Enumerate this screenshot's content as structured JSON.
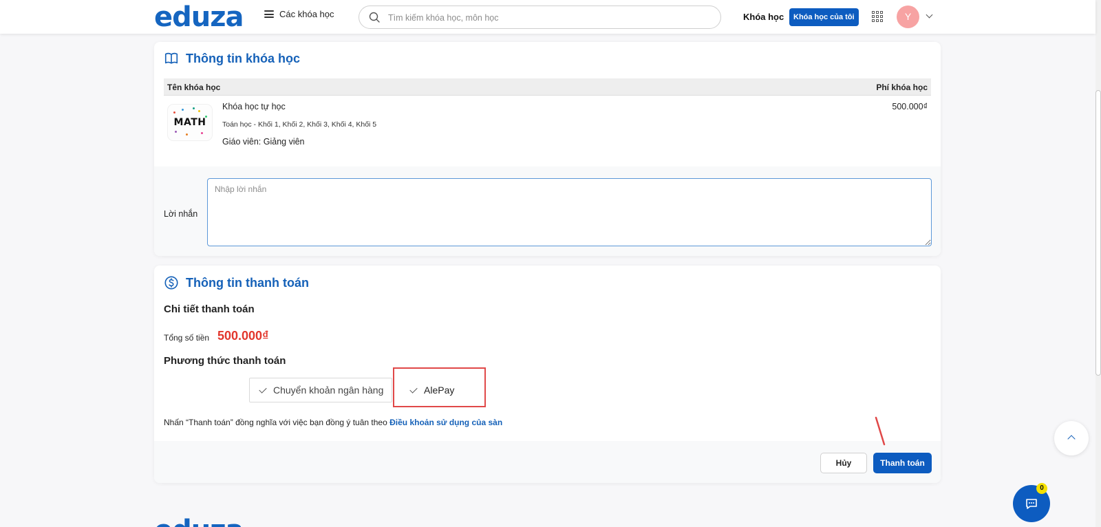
{
  "header": {
    "logo": "eduza",
    "menu_label": "Các khóa học",
    "search_placeholder": "Tìm kiếm khóa học, môn học",
    "nav_courses": "Khóa học",
    "my_courses": "Khóa học của tôi",
    "avatar_initial": "Y"
  },
  "course_card": {
    "title": "Thông tin khóa học",
    "col_name": "Tên khóa học",
    "col_fee": "Phí khóa học",
    "thumbnail_text": "MATH",
    "course": {
      "name": "Khóa học tự học",
      "subject": "Toán học - Khối 1, Khối 2, Khối 3, Khối 4, Khối 5",
      "teacher": "Giáo viên: Giảng viên",
      "price": "500.000₫"
    },
    "message_label": "Lời nhắn",
    "message_placeholder": "Nhập lời nhắn",
    "message_value": ""
  },
  "payment_card": {
    "title": "Thông tin thanh toán",
    "detail_title": "Chi tiết thanh toán",
    "total_label": "Tổng số tiền",
    "total_value": "500.000₫",
    "method_title": "Phương thức thanh toán",
    "methods": [
      {
        "label": "Chuyển khoản ngân hàng"
      },
      {
        "label": "AlePay"
      }
    ],
    "terms_prefix": "Nhấn “Thanh toán” đồng nghĩa với việc bạn đồng ý tuân theo ",
    "terms_link": "Điều khoản sử dụng của sàn",
    "cancel_label": "Hủy",
    "pay_label": "Thanh toán"
  },
  "chat": {
    "badge_count": "0"
  },
  "footer": {
    "logo": "eduza"
  },
  "colors": {
    "brand_blue": "#0d5cc0",
    "title_blue": "#1561b8",
    "price_red": "#e2362c",
    "highlight_red": "#e04848",
    "avatar_pink": "#f7a3a3",
    "badge_yellow": "#f5e100"
  },
  "icons": {
    "menu": "hamburger-icon",
    "search": "search-icon",
    "apps": "grid-icon",
    "course_title": "book-icon",
    "payment_title": "dollar-circle-icon",
    "method_check": "check-icon",
    "scroll_top": "chevron-up-icon",
    "chat": "chat-icon"
  }
}
